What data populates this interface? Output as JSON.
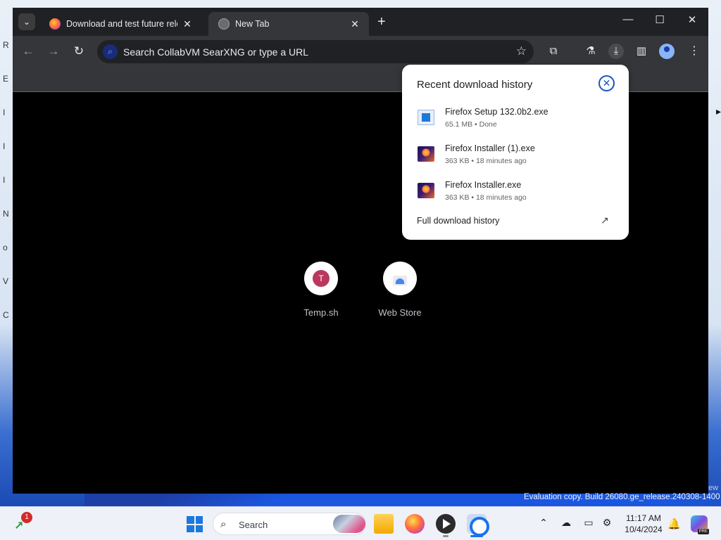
{
  "tabs": [
    {
      "title": "Download and test future rele",
      "favicon": "firefox-icon",
      "active": false
    },
    {
      "title": "New Tab",
      "favicon": "globe-icon",
      "active": true
    }
  ],
  "omnibox": {
    "text": "Search CollabVM SearXNG or type a URL"
  },
  "download_bubble": {
    "title": "Recent download history",
    "items": [
      {
        "name": "Firefox Setup 132.0b2.exe",
        "meta": "65.1 MB • Done"
      },
      {
        "name": "Firefox Installer (1).exe",
        "meta": "363 KB • 18 minutes ago"
      },
      {
        "name": "Firefox Installer.exe",
        "meta": "363 KB • 18 minutes ago"
      }
    ],
    "full_history": "Full download history"
  },
  "shortcuts": [
    {
      "label": "Temp.sh",
      "letter": "T"
    },
    {
      "label": "Web Store"
    }
  ],
  "watermark": "Evaluation copy. Build 26080.ge_release.240308-1400",
  "watermark_tail": "ew",
  "desktop_letters": [
    "R",
    "E",
    "I",
    "I",
    "I",
    "N",
    "o",
    "V",
    "C"
  ],
  "taskbar": {
    "widgets_badge": "1",
    "search_label": "Search",
    "time": "11:17 AM",
    "date": "10/4/2024",
    "copilot_badge": "PRE"
  },
  "colors": {
    "accent": "#1a56c4",
    "tab_active": "#35363a",
    "tabstrip": "#202124"
  }
}
